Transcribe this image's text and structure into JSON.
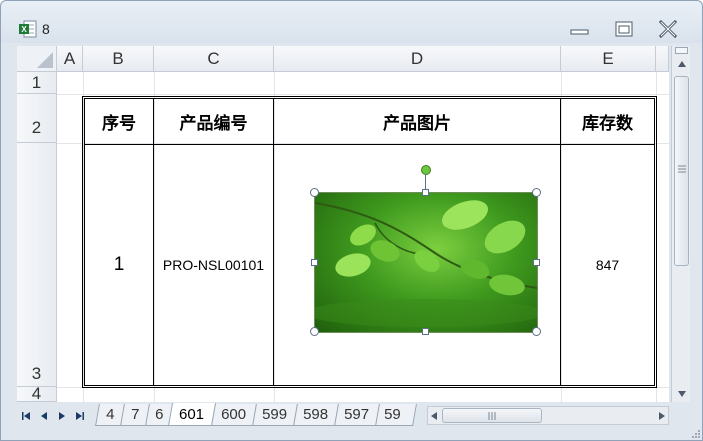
{
  "window": {
    "title": "8"
  },
  "columns": [
    "A",
    "B",
    "C",
    "D",
    "E"
  ],
  "rows": [
    "1",
    "2",
    "3",
    "4"
  ],
  "table": {
    "headers": [
      "序号",
      "产品编号",
      "产品图片",
      "库存数"
    ],
    "row": {
      "index": "1",
      "product_code": "PRO-NSL00101",
      "stock": "847"
    }
  },
  "sheet_tabs": [
    "4",
    "7",
    "6",
    "601",
    "600",
    "599",
    "598",
    "597",
    "59"
  ],
  "active_tab": "601",
  "icons": {
    "app": "excel-icon",
    "minimize": "minimize-icon",
    "maximize": "maximize-icon",
    "close": "close-icon"
  },
  "colors": {
    "accent": "#6ac63c",
    "excel_green": "#1f7a3a"
  }
}
